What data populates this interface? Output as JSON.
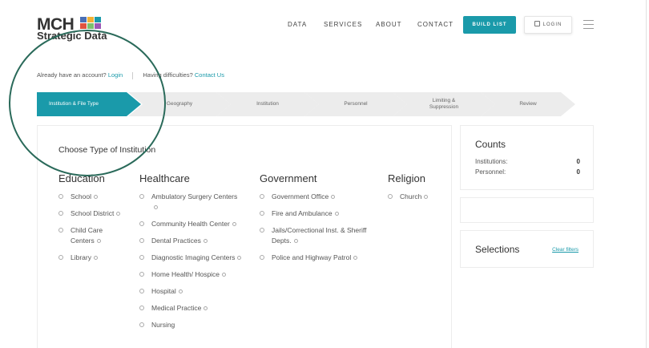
{
  "brand": {
    "logo_main": "MCH",
    "logo_sub": "Strategic Data",
    "square_colors": [
      "#4a6fb5",
      "#f2b134",
      "#1a9aaa",
      "#e0533f",
      "#7bc16e",
      "#9b59b6"
    ]
  },
  "nav": {
    "items": [
      "DATA",
      "SERVICES",
      "ABOUT",
      "CONTACT"
    ],
    "build_list": "BUILD LIST",
    "login": "LOGIN"
  },
  "account": {
    "prompt": "Already have an account?",
    "login_link": "Login",
    "difficulty_prompt": "Having difficulties?",
    "contact_link": "Contact Us"
  },
  "steps": [
    {
      "label": "Institution & File Type",
      "active": true
    },
    {
      "label": "Geography",
      "active": false
    },
    {
      "label": "Institution",
      "active": false
    },
    {
      "label": "Personnel",
      "active": false
    },
    {
      "label": "Limiting &\nSuppression",
      "active": false
    },
    {
      "label": "Review",
      "active": false
    }
  ],
  "main": {
    "choose_title": "Choose Type of Institution",
    "columns": [
      {
        "heading": "Education",
        "options": [
          "School",
          "School District",
          "Child Care Centers",
          "Library"
        ]
      },
      {
        "heading": "Healthcare",
        "options": [
          "Ambulatory Surgery Centers",
          "Community Health Center",
          "Dental Practices",
          "Diagnostic Imaging Centers",
          "Home Health/ Hospice",
          "Hospital",
          "Medical Practice",
          "Nursing"
        ]
      },
      {
        "heading": "Government",
        "options": [
          "Government Office",
          "Fire and Ambulance",
          "Jails/Correctional Inst. & Sheriff Depts.",
          "Police and Highway Patrol"
        ]
      },
      {
        "heading": "Religion",
        "options": [
          "Church"
        ]
      }
    ]
  },
  "counts": {
    "title": "Counts",
    "institutions_label": "Institutions:",
    "institutions_value": "0",
    "personnel_label": "Personnel:",
    "personnel_value": "0"
  },
  "selections": {
    "title": "Selections",
    "clear": "Clear filters"
  },
  "colors": {
    "accent": "#1a9aaa",
    "step_inactive": "#ececec",
    "overlay_circle": "#2a6a5a"
  }
}
